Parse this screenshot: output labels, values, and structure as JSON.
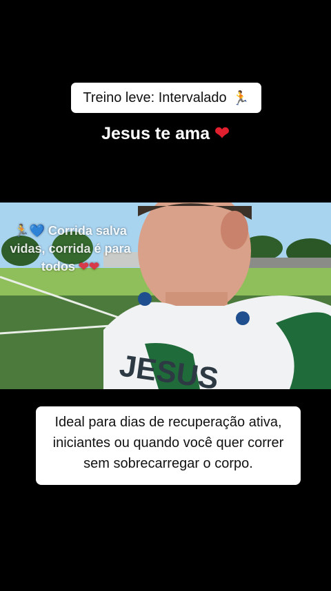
{
  "header": {
    "title": "Treino leve: Intervalado",
    "title_icon": "runner-icon",
    "subtitle": "Jesus te ama",
    "subtitle_icon": "red-heart-icon"
  },
  "video": {
    "overlay_prefix_icons": [
      "runner-icon",
      "blue-heart-icon"
    ],
    "overlay_text": "Corrida salva vidas, corrida é para todos",
    "overlay_suffix_icons": [
      "red-heart-icon",
      "red-heart-icon"
    ],
    "shirt_text": "JESUS"
  },
  "caption": {
    "line1": "Ideal para dias de recuperação ativa,",
    "line2": "iniciantes ou quando você quer correr",
    "line3": "sem sobrecarregar o corpo."
  },
  "colors": {
    "background": "#000000",
    "pill": "#ffffff",
    "heart": "#e0202e",
    "field": "#4c7a3c",
    "sky": "#a9d4f0",
    "shirt": "#f1f2f4",
    "shirt_accent": "#1f6b3a"
  }
}
